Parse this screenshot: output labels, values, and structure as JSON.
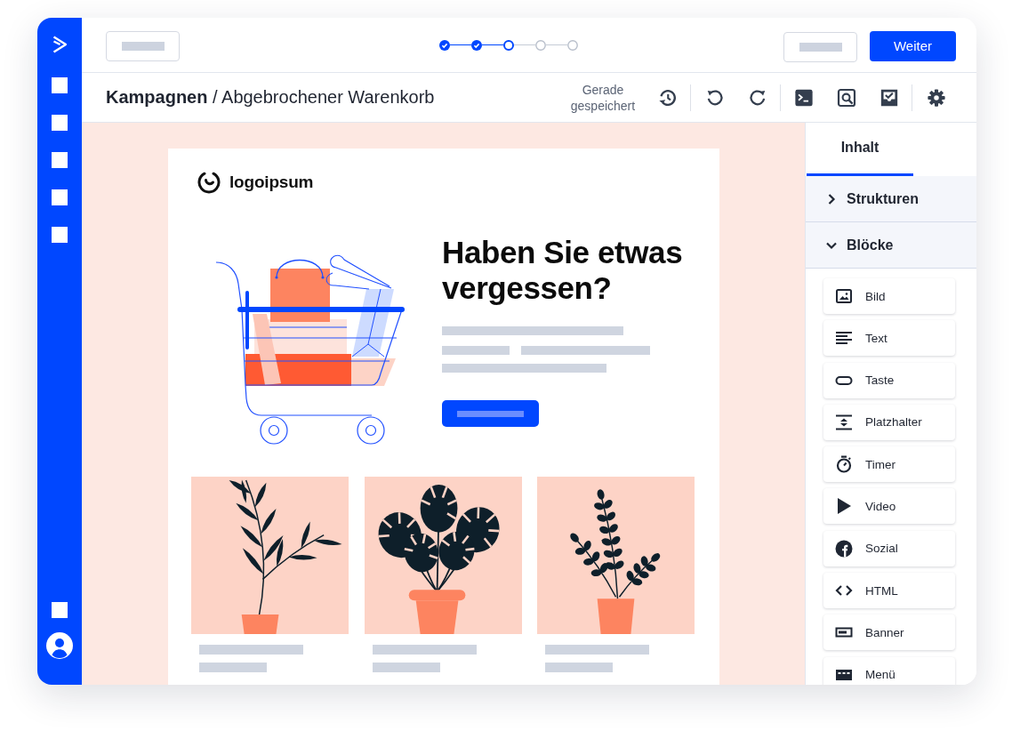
{
  "top_bar": {
    "stepper": {
      "steps": [
        {
          "completed": true,
          "selected": false
        },
        {
          "completed": true,
          "selected": false
        },
        {
          "completed": false,
          "selected": true
        },
        {
          "completed": false,
          "selected": false
        },
        {
          "completed": false,
          "selected": false
        }
      ]
    },
    "next_button": "Weiter"
  },
  "toolbar": {
    "title": "**Kampagnen** / Abgebrochener Warenkorb",
    "save_status": "Gerade gespeichert"
  },
  "email": {
    "logo_text": "logoipsum",
    "headline": "Haben Sie etwas vergessen?"
  },
  "panel": {
    "tabs": [
      {
        "label": "Inhalt",
        "selected": true
      }
    ],
    "sections": [
      {
        "label": "Strukturen",
        "expanded": false
      },
      {
        "label": "Blöcke",
        "expanded": true,
        "blocks": [
          {
            "label": "Bild",
            "kind": "image"
          },
          {
            "label": "Text",
            "kind": "text"
          },
          {
            "label": "Taste",
            "kind": "button"
          },
          {
            "label": "Platzhalter",
            "kind": "spacer"
          },
          {
            "label": "Timer",
            "kind": "timer"
          },
          {
            "label": "Video",
            "kind": "video"
          },
          {
            "label": "Sozial",
            "kind": "social"
          },
          {
            "label": "HTML",
            "kind": "html"
          },
          {
            "label": "Banner",
            "kind": "banner"
          },
          {
            "label": "Menü",
            "kind": "menu"
          }
        ]
      }
    ]
  }
}
